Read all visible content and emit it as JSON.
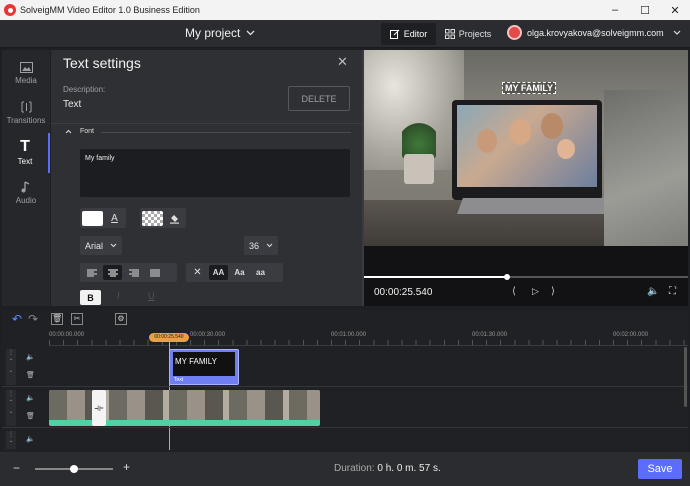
{
  "window": {
    "title": "SolveigMM Video Editor 1.0 Business Edition"
  },
  "topbar": {
    "project_name": "My project",
    "editor_label": "Editor",
    "projects_label": "Projects",
    "user_email": "olga.krovyakova@solveigmm.com"
  },
  "nav": {
    "media": "Media",
    "transitions": "Transitions",
    "text": "Text",
    "audio": "Audio"
  },
  "panel": {
    "title": "Text settings",
    "description_label": "Description:",
    "description_value": "Text",
    "delete_label": "DELETE",
    "font_section": "Font",
    "text_value": "My family",
    "font_name": "Arial",
    "font_size": "36",
    "case_all_caps": "AA",
    "case_title": "Aa",
    "case_lower": "aa",
    "bold": "B",
    "italic": "I",
    "underline": "U"
  },
  "preview": {
    "overlay_text": "MY FAMILY",
    "timecode": "00:00:25.540",
    "progress": 0.44
  },
  "timeline": {
    "ruler": [
      "00:00:00.000",
      "00:00:30.000",
      "00:01:00.000",
      "00:01:30.000",
      "00:02:00.000"
    ],
    "playhead": "00:00:25.540",
    "text_clip_title": "MY FAMILY",
    "text_clip_label": "Text"
  },
  "footer": {
    "duration_label": "Duration:",
    "duration_value": "0 h. 0 m. 57 s.",
    "save_label": "Save",
    "zoom_level": 0.5
  },
  "colors": {
    "accent": "#5b6cff",
    "video_track": "#4fd1a5",
    "text_clip": "#6f7ef0",
    "playhead": "#e8a04a"
  }
}
